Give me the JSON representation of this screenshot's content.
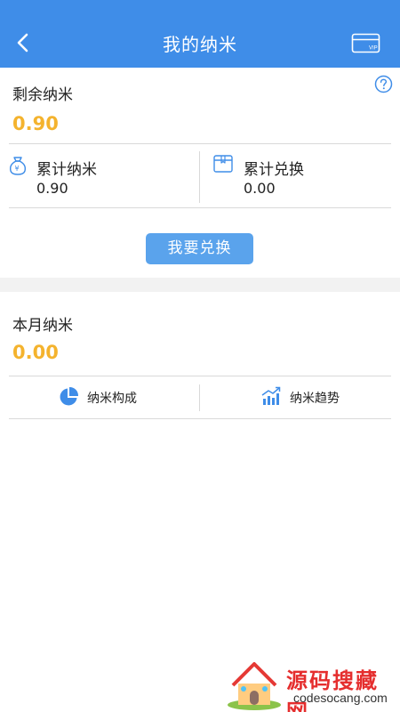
{
  "header": {
    "title": "我的纳米",
    "back_icon": "chevron-left-icon",
    "action_icon": "vip-card-icon",
    "action_icon_text": "VIP"
  },
  "balance": {
    "label": "剩余纳米",
    "value": "0.90",
    "help_icon": "question-icon"
  },
  "stats": [
    {
      "label": "累计纳米",
      "value": "0.90",
      "icon": "coin-bag-icon"
    },
    {
      "label": "累计兑换",
      "value": "0.00",
      "icon": "wallet-icon"
    }
  ],
  "exchange_button": {
    "label": "我要兑换"
  },
  "month": {
    "label": "本月纳米",
    "value": "0.00"
  },
  "tabs": [
    {
      "label": "纳米构成",
      "icon": "pie-chart-icon"
    },
    {
      "label": "纳米趋势",
      "icon": "trend-chart-icon"
    }
  ],
  "watermark": {
    "title": "源码搜藏网",
    "domain": "codesocang.com"
  },
  "colors": {
    "primary": "#3f8de8",
    "button": "#5aa3ec",
    "accent": "#f4b32e"
  }
}
